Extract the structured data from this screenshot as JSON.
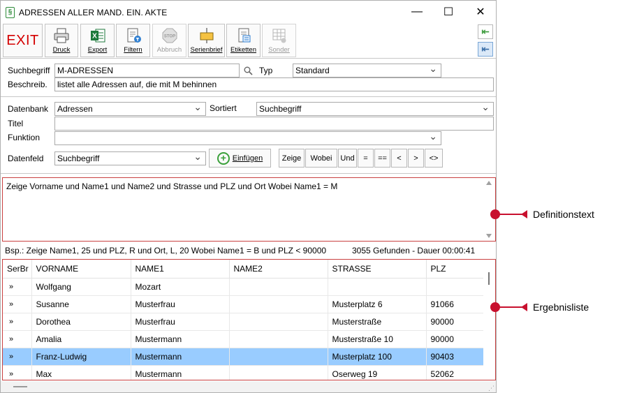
{
  "window": {
    "title": "ADRESSEN ALLER MAND. EIN. AKTE",
    "controls": {
      "minimize": "—",
      "maximize": "☐",
      "close": "✕"
    }
  },
  "toolbar": {
    "exit": "EXIT",
    "buttons": [
      {
        "label": "Druck",
        "icon": "printer-icon",
        "enabled": true
      },
      {
        "label": "Export",
        "icon": "excel-icon",
        "enabled": true
      },
      {
        "label": "Filtern",
        "icon": "filter-icon",
        "enabled": true
      },
      {
        "label": "Abbruch",
        "icon": "stop-icon",
        "enabled": false
      },
      {
        "label": "Serienbrief",
        "icon": "serial-letter-icon",
        "enabled": true
      },
      {
        "label": "Etiketten",
        "icon": "labels-icon",
        "enabled": true
      },
      {
        "label": "Sonder",
        "icon": "special-icon",
        "enabled": false
      }
    ]
  },
  "form": {
    "suchbegriff_label": "Suchbegriff",
    "suchbegriff_value": "M-ADRESSEN",
    "typ_label": "Typ",
    "typ_value": "Standard",
    "beschreib_label": "Beschreib.",
    "beschreib_value": "listet alle Adressen auf, die mit M behinnen",
    "datenbank_label": "Datenbank",
    "datenbank_value": "Adressen",
    "sortiert_label": "Sortiert",
    "sortiert_value": "Suchbegriff",
    "titel_label": "Titel",
    "titel_value": "",
    "funktion_label": "Funktion",
    "funktion_value": "",
    "datenfeld_label": "Datenfeld",
    "datenfeld_value": "Suchbegriff",
    "einfuegen_label": "Einfügen"
  },
  "operators": [
    "Zeige",
    "Wobei",
    "Und",
    "=",
    "==",
    "<",
    ">",
    "<>"
  ],
  "definition_text": "Zeige Vorname und Name1 und Name2 und Strasse und PLZ und Ort Wobei Name1 = M",
  "example_text": "Bsp.: Zeige Name1, 25 und PLZ, R und Ort, L, 20 Wobei Name1 = B und PLZ < 90000",
  "found_text": "3055 Gefunden - Dauer 00:00:41",
  "grid": {
    "columns": [
      "SerBr",
      "VORNAME",
      "NAME1",
      "NAME2",
      "STRASSE",
      "PLZ"
    ],
    "rows": [
      {
        "mark": "»",
        "vorname": "Wolfgang",
        "name1": "Mozart",
        "name2": "",
        "strasse": "",
        "plz": "",
        "selected": false
      },
      {
        "mark": "»",
        "vorname": "Susanne",
        "name1": "Musterfrau",
        "name2": "",
        "strasse": "Musterplatz 6",
        "plz": "91066",
        "selected": false
      },
      {
        "mark": "»",
        "vorname": "Dorothea",
        "name1": "Musterfrau",
        "name2": "",
        "strasse": "Musterstraße",
        "plz": "90000",
        "selected": false
      },
      {
        "mark": "»",
        "vorname": "Amalia",
        "name1": "Mustermann",
        "name2": "",
        "strasse": "Musterstraße 10",
        "plz": "90000",
        "selected": false
      },
      {
        "mark": "»",
        "vorname": "Franz-Ludwig",
        "name1": "Mustermann",
        "name2": "",
        "strasse": "Musterplatz 100",
        "plz": "90403",
        "selected": true
      },
      {
        "mark": "»",
        "vorname": "Max",
        "name1": "Mustermann",
        "name2": "",
        "strasse": "Oserweg 19",
        "plz": "52062",
        "selected": false
      }
    ]
  },
  "annotations": {
    "definitionstext": "Definitionstext",
    "ergebnisliste": "Ergebnisliste"
  },
  "colors": {
    "accent_red": "#c8102e",
    "selection": "#99ccff",
    "exit_red": "#d40000"
  }
}
